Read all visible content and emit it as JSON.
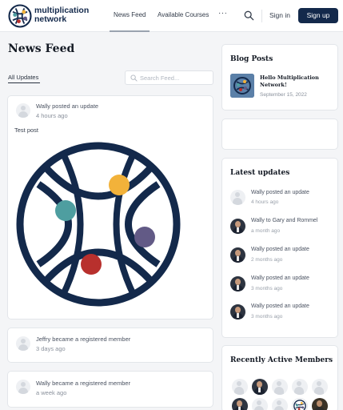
{
  "header": {
    "logo_line1": "multiplication",
    "logo_line2": "network",
    "nav": {
      "news_feed": "News Feed",
      "available_courses": "Available Courses",
      "more": "···"
    },
    "sign_in": "Sign in",
    "sign_up": "Sign up"
  },
  "main": {
    "title": "News Feed",
    "tab_all_updates": "All Updates",
    "search_placeholder": "Search Feed...",
    "activities": [
      {
        "text": "Wally posted an update",
        "time": "4 hours ago",
        "body": "Test post"
      },
      {
        "text": "Jeffry became a registered member",
        "time": "3 days ago"
      },
      {
        "text": "Wally became a registered member",
        "time": "a week ago"
      }
    ]
  },
  "sidebar": {
    "blog_posts": {
      "title": "Blog Posts",
      "post_title": "Hello Multiplication Network!",
      "post_date": "September 15, 2022"
    },
    "latest_updates": {
      "title": "Latest updates",
      "items": [
        {
          "text": "Wally posted an update",
          "time": "4 hours ago",
          "avatar": "placeholder"
        },
        {
          "text": "Wally to Gary and Rommel",
          "time": "a month ago",
          "avatar": "photo"
        },
        {
          "text": "Wally posted an update",
          "time": "2 months ago",
          "avatar": "photo"
        },
        {
          "text": "Wally posted an update",
          "time": "3 months ago",
          "avatar": "photo"
        },
        {
          "text": "Wally posted an update",
          "time": "3 months ago",
          "avatar": "photo"
        }
      ]
    },
    "recently_active": {
      "title": "Recently Active Members"
    }
  },
  "colors": {
    "brand_navy": "#13294b",
    "logo_yellow": "#f2b23a",
    "logo_teal": "#4e9ea0",
    "logo_purple": "#625a86",
    "logo_red": "#b8302d",
    "page_bg": "#f4f5f7"
  },
  "icons": [
    "search-icon",
    "more-icon",
    "avatar-placeholder-icon"
  ]
}
